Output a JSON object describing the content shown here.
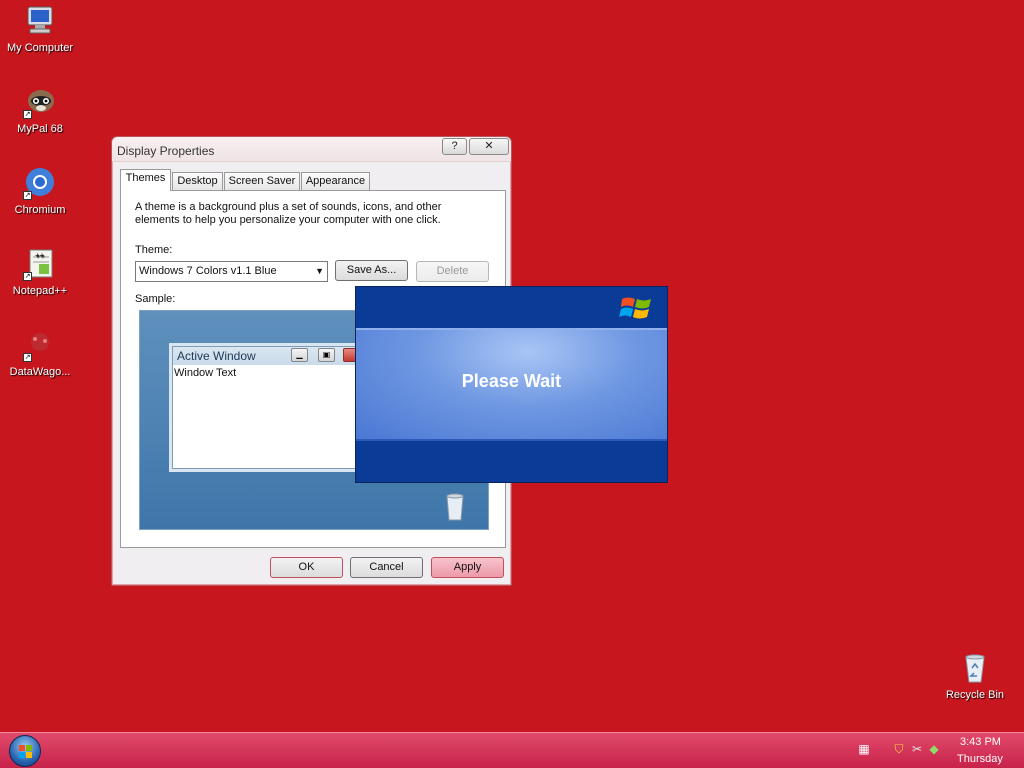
{
  "desktop": {
    "icons": [
      {
        "label": "My Computer"
      },
      {
        "label": "MyPal 68"
      },
      {
        "label": "Chromium"
      },
      {
        "label": "Notepad++"
      },
      {
        "label": "DataWago..."
      },
      {
        "label": "Recycle Bin"
      }
    ],
    "background_color": "#c8161e"
  },
  "dialog": {
    "title": "Display Properties",
    "help_label": "?",
    "close_label": "✕",
    "tabs": [
      {
        "label": "Themes",
        "active": true
      },
      {
        "label": "Desktop"
      },
      {
        "label": "Screen Saver"
      },
      {
        "label": "Appearance"
      }
    ],
    "description": "A theme is a background plus a set of sounds, icons, and other elements to help you personalize your computer with one click.",
    "theme_label": "Theme:",
    "theme_value": "Windows 7 Colors v1.1 Blue",
    "save_as_label": "Save As...",
    "delete_label": "Delete",
    "sample_label": "Sample:",
    "sample": {
      "window_title": "Active Window",
      "window_text": "Window Text"
    },
    "ok_label": "OK",
    "cancel_label": "Cancel",
    "apply_label": "Apply"
  },
  "please_wait": {
    "message": "Please Wait"
  },
  "taskbar": {
    "time": "3:43 PM",
    "day": "Thursday"
  }
}
